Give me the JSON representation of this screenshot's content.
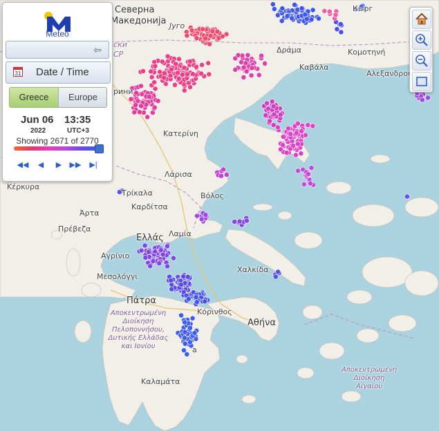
{
  "app": {
    "logo_text": "Meteo"
  },
  "panel": {
    "datetime_label": "Date / Time",
    "calendar_day": "31",
    "tabs": {
      "greece": "Greece",
      "europe": "Europe",
      "active": "greece"
    },
    "date": "Jun 06",
    "year": "2022",
    "time": "13:35",
    "timezone": "UTC+3",
    "showing_text": "Showing 2671 of 2770",
    "showing_count": 2671,
    "total_count": 2770
  },
  "colors": {
    "brand": "#1e3fb0",
    "logo_sun": "#f5c400",
    "active_tab": "#a6cf71",
    "strike_gradient": [
      "#f06a2a",
      "#e83868",
      "#ea39b8",
      "#c045e0",
      "#6b4cf0",
      "#3a55f0"
    ],
    "sea": "#aad3df",
    "land": "#f2efe9"
  },
  "icons": [
    "calendar-icon",
    "collapse-left-icon",
    "rewind-icon",
    "step-back-icon",
    "step-forward-icon",
    "fast-forward-icon",
    "skip-end-icon",
    "home-icon",
    "zoom-in-icon",
    "zoom-out-icon",
    "fullscreen-icon"
  ],
  "map": {
    "places": [
      {
        "id": "severna",
        "label": "Северна"
      },
      {
        "id": "makedonija",
        "label": "Македонија"
      },
      {
        "id": "yugo",
        "label": "Југо"
      },
      {
        "id": "drama",
        "label": "Δράμα"
      },
      {
        "id": "komotini",
        "label": "Κομοτηνή"
      },
      {
        "id": "kavala",
        "label": "Καβάλα"
      },
      {
        "id": "alexandroupoli",
        "label": "Αλεξανδρούπολη"
      },
      {
        "id": "sk",
        "label": "ски"
      },
      {
        "id": "cp",
        "label": "CP"
      },
      {
        "id": "rini",
        "label": "рини"
      },
      {
        "id": "katerini",
        "label": "Κατερίνη"
      },
      {
        "id": "larisa",
        "label": "Λάρισα"
      },
      {
        "id": "kerkyra",
        "label": "Κέρκυρα"
      },
      {
        "id": "trikala",
        "label": "Τρίκαλα"
      },
      {
        "id": "volos",
        "label": "Βόλος"
      },
      {
        "id": "arta",
        "label": "Άρτα"
      },
      {
        "id": "karditsa",
        "label": "Καρδίτσα"
      },
      {
        "id": "preveza",
        "label": "Πρέβεζα"
      },
      {
        "id": "ellas",
        "label": "Ελλάς"
      },
      {
        "id": "lamia",
        "label": "Λαμία"
      },
      {
        "id": "agrinio",
        "label": "Αγρίνιο"
      },
      {
        "id": "mesolongi",
        "label": "Μεσολόγγι"
      },
      {
        "id": "chalkida",
        "label": "Χαλκίδα"
      },
      {
        "id": "patra",
        "label": "Πάτρα"
      },
      {
        "id": "korinthos",
        "label": "Κόρινθος"
      },
      {
        "id": "athina",
        "label": "Αθήνα"
      },
      {
        "id": "kalamata",
        "label": "Καλαμάτα"
      },
      {
        "id": "kyrg",
        "label": "Кырг"
      },
      {
        "id": "a",
        "label": "a"
      }
    ],
    "regions": [
      {
        "id": "west-greece",
        "label": "Αποκεντρωμένη Διοίκηση Πελοποννήσου, Δυτικής Ελλάδας και Ιονίου"
      },
      {
        "id": "aegean",
        "label": "Αποκεντρωμένη Διοίκηση Αιγαίου"
      }
    ]
  }
}
